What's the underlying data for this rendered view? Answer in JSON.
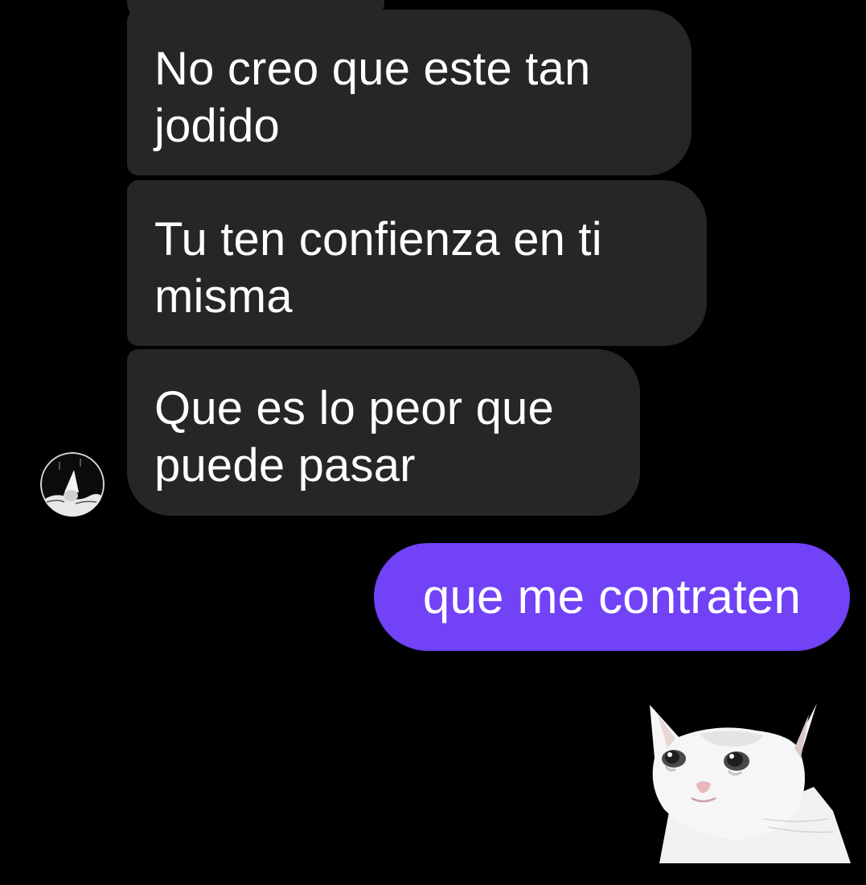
{
  "conversation": {
    "received_messages": [
      {
        "text": "No creo que este tan\njodido"
      },
      {
        "text": "Tu ten confienza en ti\nmisma"
      },
      {
        "text": "Que es lo peor que\npuede pasar"
      }
    ],
    "sent_messages": [
      {
        "text": "que me contraten"
      }
    ],
    "sticker": {
      "icon": "crying-cat-icon"
    },
    "avatar": {
      "icon": "avatar-wizard-icon"
    }
  },
  "colors": {
    "background": "#000000",
    "received_bubble": "#262626",
    "sent_bubble": "#7142f6",
    "text": "#ffffff"
  }
}
